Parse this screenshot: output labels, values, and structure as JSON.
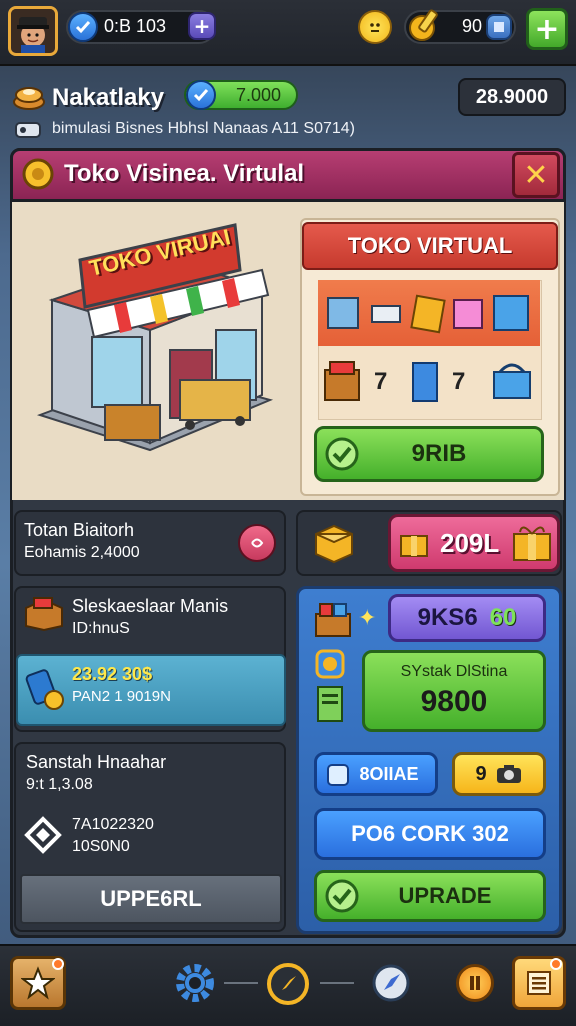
{
  "topbar": {
    "stat_value": "0:B  103",
    "gold_value": "90"
  },
  "profile": {
    "name": "Nakatlaky",
    "verified_value": "7.000",
    "balance": "28.9000",
    "subtitle": "bimulasi Bisnes Hbhsl Nanaas A11 S0714)"
  },
  "panel": {
    "title": "Toko Visinea. Virtulal",
    "shop_sign": "TOKO VIRUAI",
    "card_title": "TOKO VIRTUAL",
    "item_counts": [
      "7",
      "7"
    ],
    "card_button": "9RIB"
  },
  "stats": {
    "total_label": "Totan Biaitorh",
    "total_value": "Eohamis 2,4000",
    "pink_value": "209L"
  },
  "sales": {
    "title": "Sleskaeslaar Manis",
    "subtitle": "ID:hnuS",
    "teal_value1": "23.92 30$",
    "teal_value2": "PAN2 1 9019N"
  },
  "storage": {
    "title": "Sanstah Hnaahar",
    "value": "9:t 1,3.08",
    "item_line1": "7A1022320",
    "item_line2": "10S0N0",
    "upgrade_label": "UPPE6RL"
  },
  "blue_panel": {
    "purple_value_a": "9KS6",
    "purple_value_b": "60",
    "green_title": "SYstak DlStina",
    "green_value": "9800",
    "btn_left": "8OIIAE",
    "btn_right": "9",
    "work_button": "PO6 CORK 302",
    "upgrade_button": "UPRADE"
  },
  "colors": {
    "accent_pink": "#b73e72",
    "green": "#45b02b",
    "blue": "#2a6fde",
    "gold": "#f6b51a"
  },
  "icons": [
    "avatar",
    "check-icon",
    "plus-icon",
    "smiley-icon",
    "gold-icon",
    "close-icon",
    "gear-icon",
    "compass-icon",
    "pause-icon",
    "list-icon",
    "star-icon"
  ]
}
